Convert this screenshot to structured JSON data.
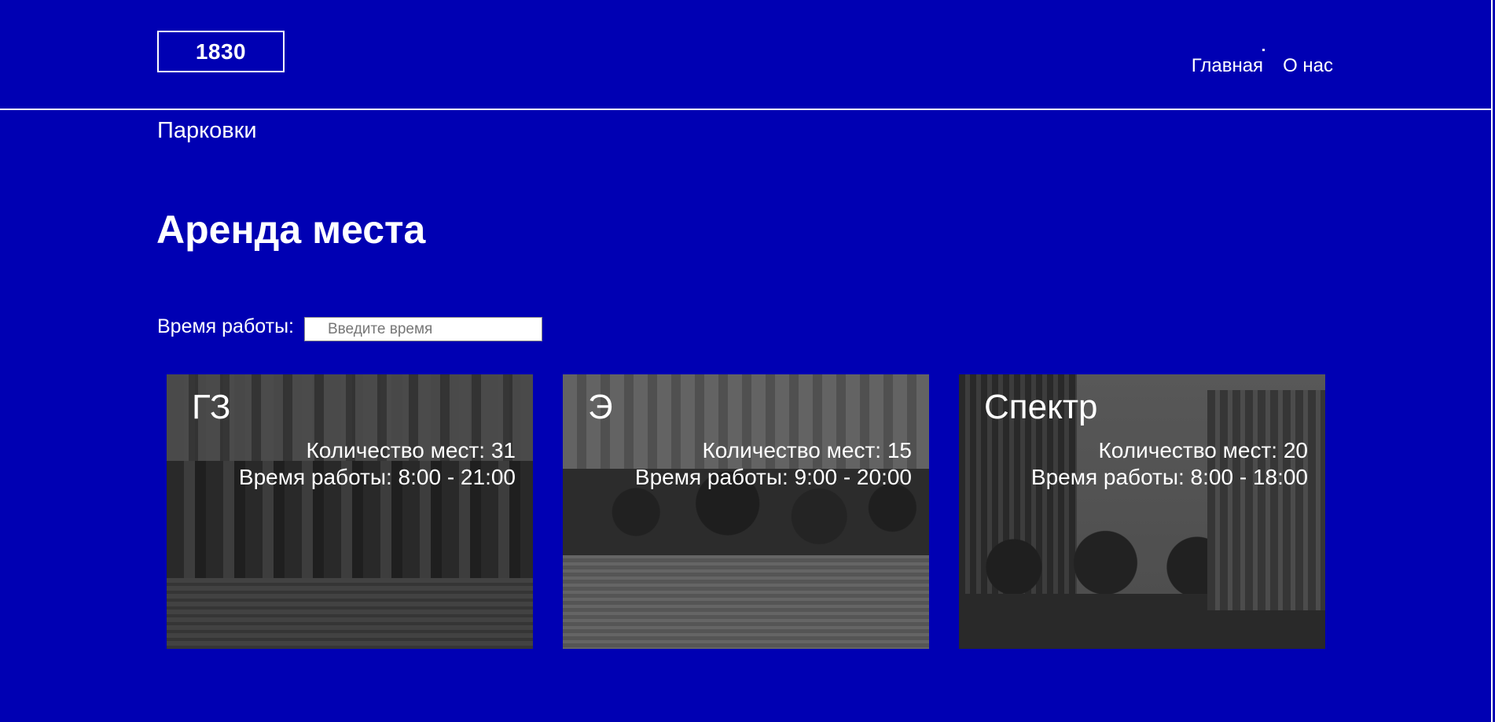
{
  "header": {
    "logo": "1830",
    "nav": [
      {
        "label": "Главная",
        "active": true
      },
      {
        "label": "О нас",
        "active": false
      }
    ]
  },
  "section_link": "Парковки",
  "page_title": "Аренда места",
  "filter": {
    "label": "Время работы:",
    "placeholder": "Введите время",
    "value": ""
  },
  "cards": [
    {
      "title": "ГЗ",
      "spots": "Количество мест: 31",
      "hours": "Время работы: 8:00 - 21:00"
    },
    {
      "title": "Э",
      "spots": "Количество мест: 15",
      "hours": "Время работы: 9:00 - 20:00"
    },
    {
      "title": "Спектр",
      "spots": "Количество мест: 20",
      "hours": "Время работы: 8:00 - 18:00"
    }
  ],
  "colors": {
    "background": "#0000b3",
    "text": "#ffffff"
  }
}
